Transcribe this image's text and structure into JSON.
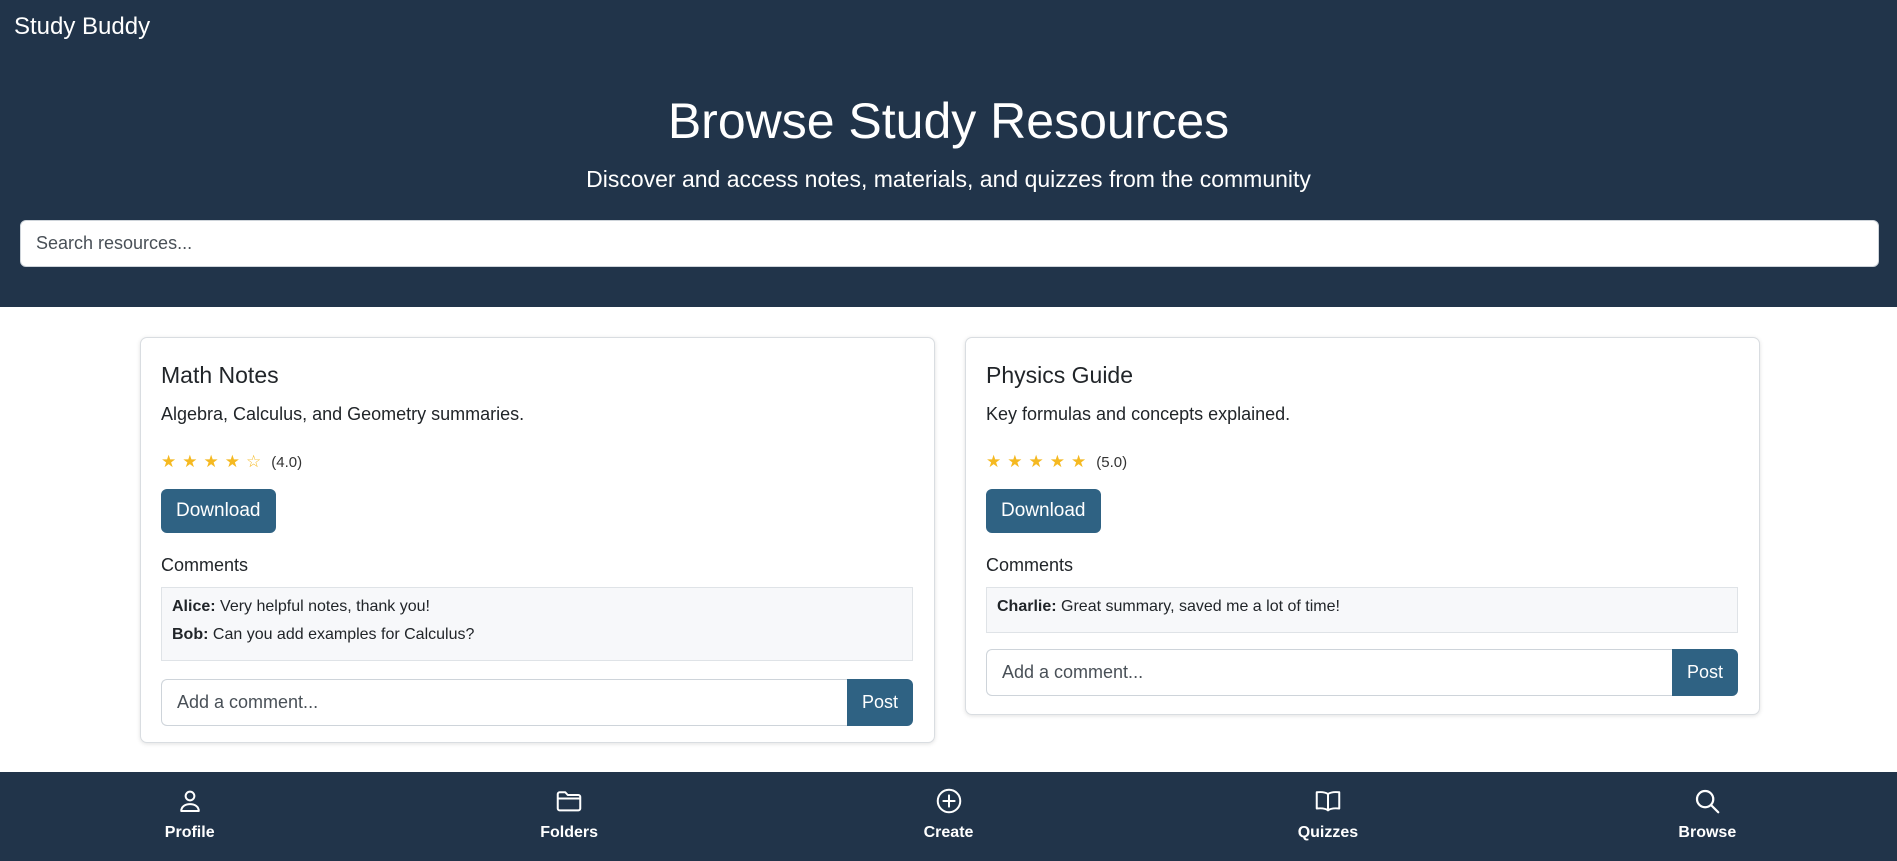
{
  "app": {
    "brand": "Study Buddy"
  },
  "hero": {
    "title": "Browse Study Resources",
    "subtitle": "Discover and access notes, materials, and quizzes from the community"
  },
  "search": {
    "placeholder": "Search resources...",
    "value": ""
  },
  "colors": {
    "header_bg": "#21344a",
    "accent": "#2f6283",
    "star": "#f5b921"
  },
  "resources": [
    {
      "title": "Math Notes",
      "description": "Algebra, Calculus, and Geometry summaries.",
      "rating": 4,
      "rating_max": 5,
      "rating_label": "(4.0)",
      "download_label": "Download",
      "comments_heading": "Comments",
      "comments": [
        {
          "author": "Alice:",
          "text": "Very helpful notes, thank you!"
        },
        {
          "author": "Bob:",
          "text": "Can you add examples for Calculus?"
        }
      ],
      "comment_placeholder": "Add a comment...",
      "post_label": "Post"
    },
    {
      "title": "Physics Guide",
      "description": "Key formulas and concepts explained.",
      "rating": 5,
      "rating_max": 5,
      "rating_label": "(5.0)",
      "download_label": "Download",
      "comments_heading": "Comments",
      "comments": [
        {
          "author": "Charlie:",
          "text": "Great summary, saved me a lot of time!"
        }
      ],
      "comment_placeholder": "Add a comment...",
      "post_label": "Post"
    }
  ],
  "bottom_nav": [
    {
      "label": "Profile",
      "icon": "person-icon"
    },
    {
      "label": "Folders",
      "icon": "folder-icon"
    },
    {
      "label": "Create",
      "icon": "plus-circle-icon"
    },
    {
      "label": "Quizzes",
      "icon": "book-icon"
    },
    {
      "label": "Browse",
      "icon": "search-icon"
    }
  ]
}
